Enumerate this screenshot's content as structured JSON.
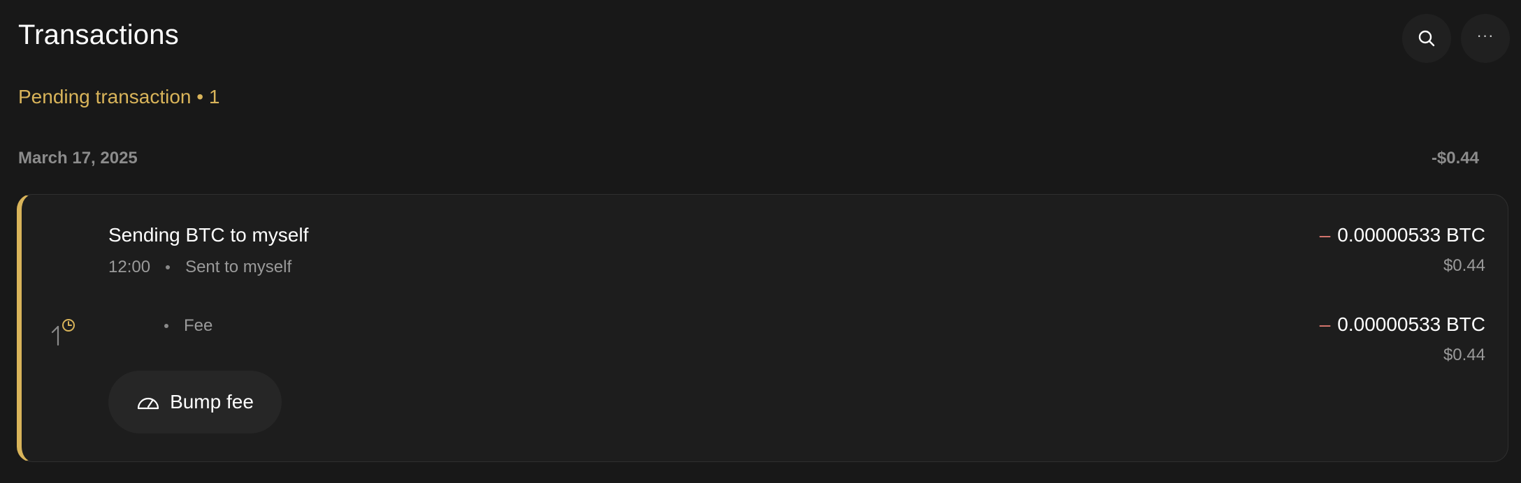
{
  "header": {
    "title": "Transactions",
    "search_icon": "search-icon",
    "more_label": "···",
    "more_icon": "more-horizontal-icon"
  },
  "pending": {
    "title": "Pending transaction • 1"
  },
  "group": {
    "date": "March 17, 2025",
    "total": "-$0.44"
  },
  "transaction": {
    "title": "Sending BTC to myself",
    "time": "12:00",
    "description": "Sent to myself",
    "status_icon": "arrow-up-pending-icon",
    "amount": {
      "sign": "–",
      "crypto": "0.00000533 BTC",
      "fiat": "$0.44"
    },
    "fee": {
      "label": "Fee",
      "sign": "–",
      "crypto": "0.00000533 BTC",
      "fiat": "$0.44"
    },
    "bump_fee_label": "Bump fee",
    "bump_fee_icon": "gauge-icon"
  },
  "colors": {
    "background": "#181818",
    "card": "#1d1d1d",
    "accent": "#d9b45a",
    "negative": "#e07a72",
    "muted": "#9a9a9a"
  }
}
